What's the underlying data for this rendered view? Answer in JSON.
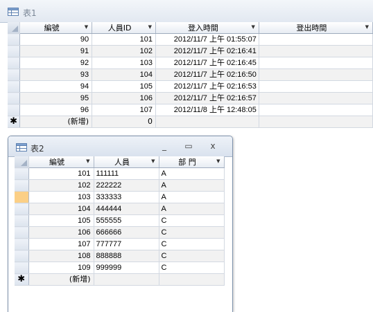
{
  "table1": {
    "title": "表1",
    "columns": [
      "編號",
      "人員ID",
      "登入時間",
      "登出時間"
    ],
    "rows": [
      {
        "id": "90",
        "person": "101",
        "login": "2012/11/7 上午 01:55:07",
        "logout": ""
      },
      {
        "id": "91",
        "person": "102",
        "login": "2012/11/7 上午 02:16:41",
        "logout": ""
      },
      {
        "id": "92",
        "person": "103",
        "login": "2012/11/7 上午 02:16:45",
        "logout": ""
      },
      {
        "id": "93",
        "person": "104",
        "login": "2012/11/7 上午 02:16:50",
        "logout": ""
      },
      {
        "id": "94",
        "person": "105",
        "login": "2012/11/7 上午 02:16:53",
        "logout": ""
      },
      {
        "id": "95",
        "person": "106",
        "login": "2012/11/7 上午 02:16:57",
        "logout": ""
      },
      {
        "id": "96",
        "person": "107",
        "login": "2012/11/8 上午 12:48:05",
        "logout": ""
      }
    ],
    "new_row": {
      "marker": "✱",
      "id": "(新增)",
      "person": "0"
    }
  },
  "table2": {
    "title": "表2",
    "columns": [
      "編號",
      "人員",
      "部 門"
    ],
    "rows": [
      {
        "id": "101",
        "person": "111111",
        "dept": "A"
      },
      {
        "id": "102",
        "person": "222222",
        "dept": "A"
      },
      {
        "id": "103",
        "person": "333333",
        "dept": "A"
      },
      {
        "id": "104",
        "person": "444444",
        "dept": "A"
      },
      {
        "id": "105",
        "person": "555555",
        "dept": "C"
      },
      {
        "id": "106",
        "person": "666666",
        "dept": "C"
      },
      {
        "id": "107",
        "person": "777777",
        "dept": "C"
      },
      {
        "id": "108",
        "person": "888888",
        "dept": "C"
      },
      {
        "id": "109",
        "person": "999999",
        "dept": "C"
      }
    ],
    "new_row": {
      "marker": "✱",
      "id": "(新增)"
    },
    "window_buttons": {
      "minimize": "_",
      "maximize": "▭",
      "close": "x"
    }
  },
  "icons": {
    "table": "table-icon",
    "dropdown": "dropdown-arrow-icon",
    "new_record": "asterisk-icon"
  },
  "colors": {
    "header_bg": "#e7ecf3",
    "selected_row_marker": "#fbcf86",
    "alt_row": "#f2f2f2"
  }
}
